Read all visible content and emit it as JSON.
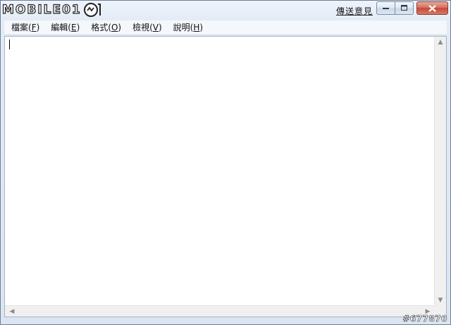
{
  "logo": {
    "text": "MOBILE01"
  },
  "titlebar": {
    "feedback_link": "傳送意見"
  },
  "menu": [
    {
      "label": "檔案(",
      "key": "F",
      "end": ")"
    },
    {
      "label": "編輯(",
      "key": "E",
      "end": ")"
    },
    {
      "label": "格式(",
      "key": "O",
      "end": ")"
    },
    {
      "label": "檢視(",
      "key": "V",
      "end": ")"
    },
    {
      "label": "說明(",
      "key": "H",
      "end": ")"
    }
  ],
  "editor": {
    "content": ""
  },
  "watermark": "#677870",
  "colors": {
    "close_button": "#c34a35",
    "frame": "#dbe5f1"
  }
}
